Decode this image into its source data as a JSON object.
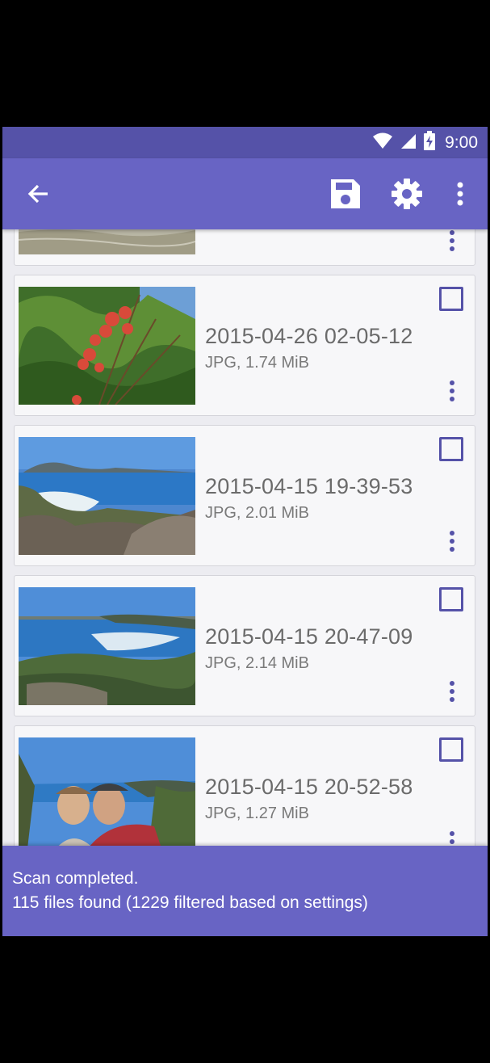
{
  "status_bar": {
    "time": "9:00",
    "icons": [
      "wifi-icon",
      "cell-signal-icon",
      "battery-charging-icon"
    ]
  },
  "toolbar": {
    "back_icon": "arrow-back-icon",
    "save_icon": "save-icon",
    "settings_icon": "settings-gear-icon",
    "more_icon": "overflow-menu-icon"
  },
  "files": [
    {
      "date": "2015-04-26 02-05-12",
      "meta": "JPG, 1.74 MiB",
      "checked": false
    },
    {
      "date": "2015-04-15 19-39-53",
      "meta": "JPG, 2.01 MiB",
      "checked": false
    },
    {
      "date": "2015-04-15 20-47-09",
      "meta": "JPG, 2.14 MiB",
      "checked": false
    },
    {
      "date": "2015-04-15 20-52-58",
      "meta": "JPG, 1.27 MiB",
      "checked": false
    }
  ],
  "snackbar": {
    "line1": "Scan completed.",
    "line2": "115 files found (1229 filtered based on settings)"
  },
  "colors": {
    "primary": "#6864c4",
    "primary_dark": "#5552a8",
    "background": "#ececf1"
  }
}
